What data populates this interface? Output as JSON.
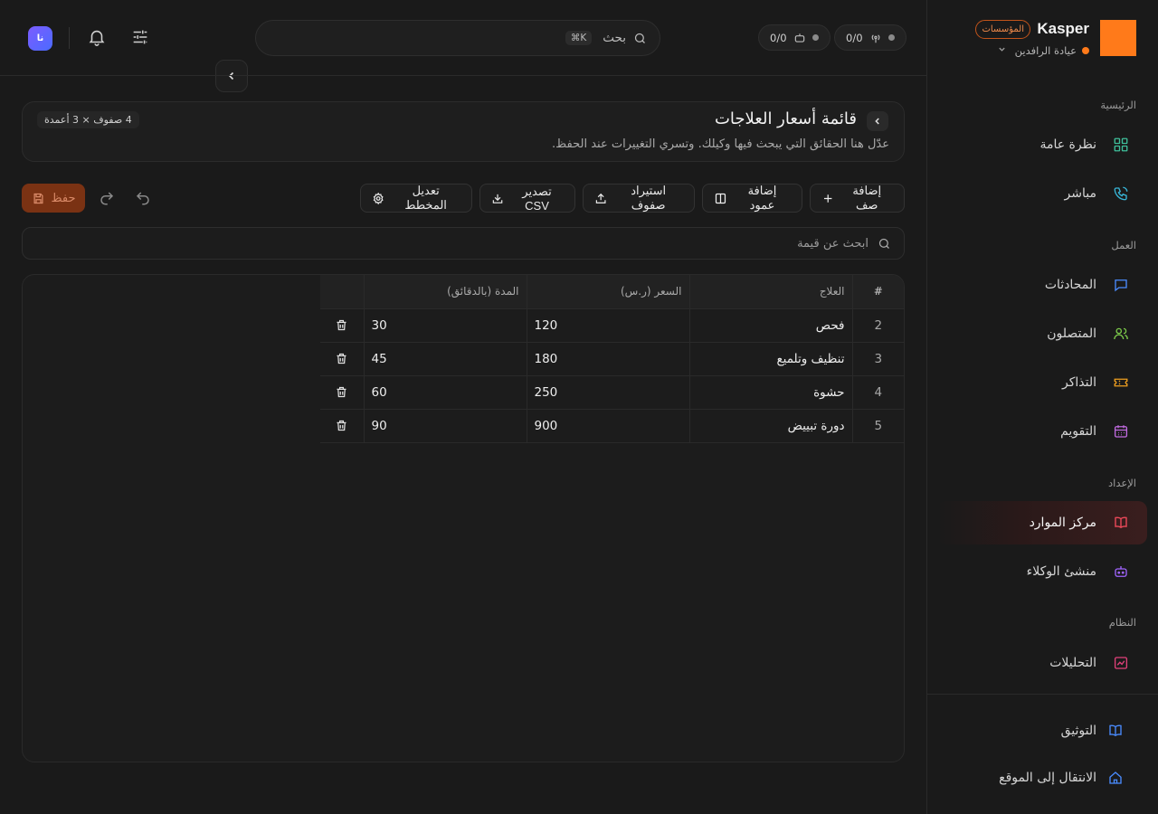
{
  "brand": {
    "name": "Kasper",
    "badge": "المؤسسات",
    "clinic": "عيادة الرافدين"
  },
  "topbar": {
    "status_1": "0/0",
    "status_2": "0/0",
    "search_label": "بحث",
    "search_kbd": "⌘K",
    "avatar_initials": "نا"
  },
  "sidebar": {
    "sections": [
      {
        "title": "الرئيسية"
      },
      {
        "title": "العمل"
      },
      {
        "title": "الإعداد"
      },
      {
        "title": "النظام"
      }
    ],
    "items": [
      {
        "label": "نظرة عامة",
        "icon": "grid-icon",
        "color": "#3fbf9a"
      },
      {
        "label": "مباشر",
        "icon": "phone-icon",
        "color": "#38b6d8"
      },
      {
        "label": "المحادثات",
        "icon": "chat-icon",
        "color": "#4a8cff"
      },
      {
        "label": "المتصلون",
        "icon": "users-icon",
        "color": "#7cc94a"
      },
      {
        "label": "التذاكر",
        "icon": "ticket-icon",
        "color": "#f0a020"
      },
      {
        "label": "التقويم",
        "icon": "calendar-icon",
        "color": "#c06adf"
      },
      {
        "label": "مركز الموارد",
        "icon": "book-icon",
        "color": "#f04a5a",
        "active": true
      },
      {
        "label": "منشئ الوكلاء",
        "icon": "bot-icon",
        "color": "#a064ff"
      },
      {
        "label": "التحليلات",
        "icon": "chart-icon",
        "color": "#e0407a"
      }
    ],
    "footer": [
      {
        "label": "التوثيق",
        "icon": "book-open-icon",
        "color": "#4a8cff"
      },
      {
        "label": "الانتقال إلى الموقع",
        "icon": "home-icon",
        "color": "#4a8cff"
      }
    ]
  },
  "page": {
    "title": "قائمة أسعار العلاجات",
    "description": "عدّل هنا الحقائق التي يبحث فيها وكيلك. وتسري التغييرات عند الحفظ.",
    "dims": "4 صفوف × 3 أعمدة"
  },
  "toolbar": {
    "add_row": "إضافة صف",
    "add_column": "إضافة عمود",
    "import_rows": "استيراد صفوف",
    "export_csv": "تصدير CSV",
    "edit_schema": "تعديل المخطط",
    "save": "حفظ"
  },
  "value_search": {
    "placeholder": "ابحث عن قيمة"
  },
  "table": {
    "headers": {
      "index": "#",
      "treatment": "العلاج",
      "price": "السعر (ر.س)",
      "duration": "المدة (بالدقائق)"
    },
    "rows": [
      {
        "index": "2",
        "treatment": "فحص",
        "price": "120",
        "duration": "30"
      },
      {
        "index": "3",
        "treatment": "تنظيف وتلميع",
        "price": "180",
        "duration": "45"
      },
      {
        "index": "4",
        "treatment": "حشوة",
        "price": "250",
        "duration": "60"
      },
      {
        "index": "5",
        "treatment": "دورة تبييض",
        "price": "900",
        "duration": "90"
      }
    ]
  },
  "colors": {
    "accent": "#ff7a1a",
    "save_bg": "#7a3213",
    "background": "#1a1a1a"
  }
}
